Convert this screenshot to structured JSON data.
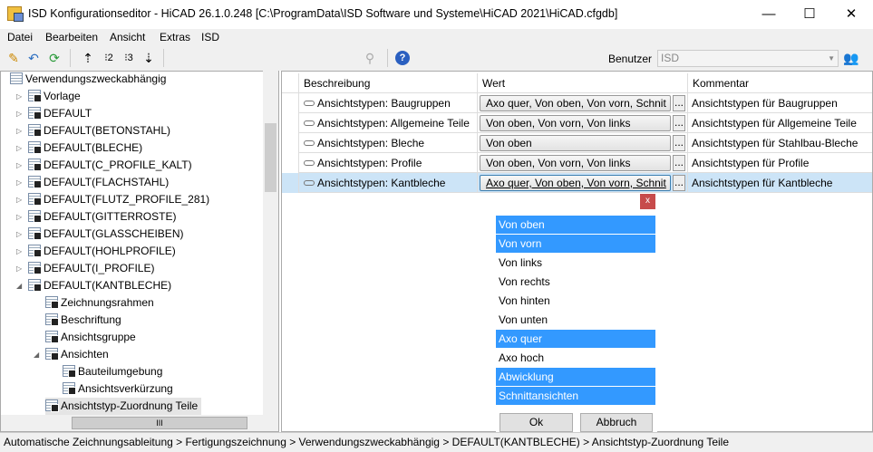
{
  "window": {
    "title": "ISD Konfigurationseditor  - HiCAD 26.1.0.248 [C:\\ProgramData\\ISD Software und Systeme\\HiCAD 2021\\HiCAD.cfgdb]",
    "minimize": "—",
    "maximize": "☐",
    "close": "✕"
  },
  "menu": [
    "Datei",
    "Bearbeiten",
    "Ansicht",
    "Extras",
    "ISD"
  ],
  "toolbar": {
    "user_label": "Benutzer",
    "user_value": "ISD"
  },
  "tree": [
    {
      "label": "Verwendungszweckabhängig",
      "level": 0
    },
    {
      "label": "Vorlage",
      "level": 1,
      "exp": "▷"
    },
    {
      "label": "DEFAULT",
      "level": 1,
      "exp": "▷"
    },
    {
      "label": "DEFAULT(BETONSTAHL)",
      "level": 1,
      "exp": "▷"
    },
    {
      "label": "DEFAULT(BLECHE)",
      "level": 1,
      "exp": "▷"
    },
    {
      "label": "DEFAULT(C_PROFILE_KALT)",
      "level": 1,
      "exp": "▷"
    },
    {
      "label": "DEFAULT(FLACHSTAHL)",
      "level": 1,
      "exp": "▷"
    },
    {
      "label": "DEFAULT(FLUTZ_PROFILE_281)",
      "level": 1,
      "exp": "▷"
    },
    {
      "label": "DEFAULT(GITTERROSTE)",
      "level": 1,
      "exp": "▷"
    },
    {
      "label": "DEFAULT(GLASSCHEIBEN)",
      "level": 1,
      "exp": "▷"
    },
    {
      "label": "DEFAULT(HOHLPROFILE)",
      "level": 1,
      "exp": "▷"
    },
    {
      "label": "DEFAULT(I_PROFILE)",
      "level": 1,
      "exp": "▷"
    },
    {
      "label": "DEFAULT(KANTBLECHE)",
      "level": 1,
      "exp": "◢"
    },
    {
      "label": "Zeichnungsrahmen",
      "level": 2
    },
    {
      "label": "Beschriftung",
      "level": 2
    },
    {
      "label": "Ansichtsgruppe",
      "level": 2
    },
    {
      "label": "Ansichten",
      "level": 2,
      "exp": "◢"
    },
    {
      "label": "Bauteilumgebung",
      "level": 3
    },
    {
      "label": "Ansichtsverkürzung",
      "level": 3
    },
    {
      "label": "Ansichtstyp-Zuordnung Teile",
      "level": 2,
      "selected": true
    }
  ],
  "grid": {
    "headers": [
      "Beschreibung",
      "Wert",
      "Kommentar"
    ],
    "rows": [
      {
        "desc": "Ansichtstypen: Baugruppen",
        "value": "Axo quer, Von oben, Von vorn, Schnit",
        "comment": "Ansichtstypen für Baugruppen"
      },
      {
        "desc": "Ansichtstypen: Allgemeine Teile",
        "value": "Von oben, Von vorn, Von links",
        "comment": "Ansichtstypen für Allgemeine Teile"
      },
      {
        "desc": "Ansichtstypen: Bleche",
        "value": "Von oben",
        "comment": "Ansichtstypen für Stahlbau-Bleche"
      },
      {
        "desc": "Ansichtstypen: Profile",
        "value": "Von oben, Von vorn, Von links",
        "comment": "Ansichtstypen für Profile"
      },
      {
        "desc": "Ansichtstypen: Kantbleche",
        "value": "Axo quer, Von oben, Von vorn, Schnit",
        "comment": "Ansichtstypen für Kantbleche",
        "selected": true
      }
    ],
    "ellipsis": "..."
  },
  "popup": {
    "close": "x",
    "items": [
      {
        "label": "Von oben",
        "selected": true
      },
      {
        "label": "Von vorn",
        "selected": true
      },
      {
        "label": "Von links",
        "selected": false
      },
      {
        "label": "Von rechts",
        "selected": false
      },
      {
        "label": "Von hinten",
        "selected": false
      },
      {
        "label": "Von unten",
        "selected": false
      },
      {
        "label": "Axo quer",
        "selected": true
      },
      {
        "label": "Axo hoch",
        "selected": false
      },
      {
        "label": "Abwicklung",
        "selected": true
      },
      {
        "label": "Schnittansichten",
        "selected": true
      }
    ],
    "ok": "Ok",
    "cancel": "Abbruch"
  },
  "status": "Automatische Zeichnungsableitung > Fertigungszeichnung > Verwendungszweckabhängig > DEFAULT(KANTBLECHE) > Ansichtstyp-Zuordnung Teile"
}
